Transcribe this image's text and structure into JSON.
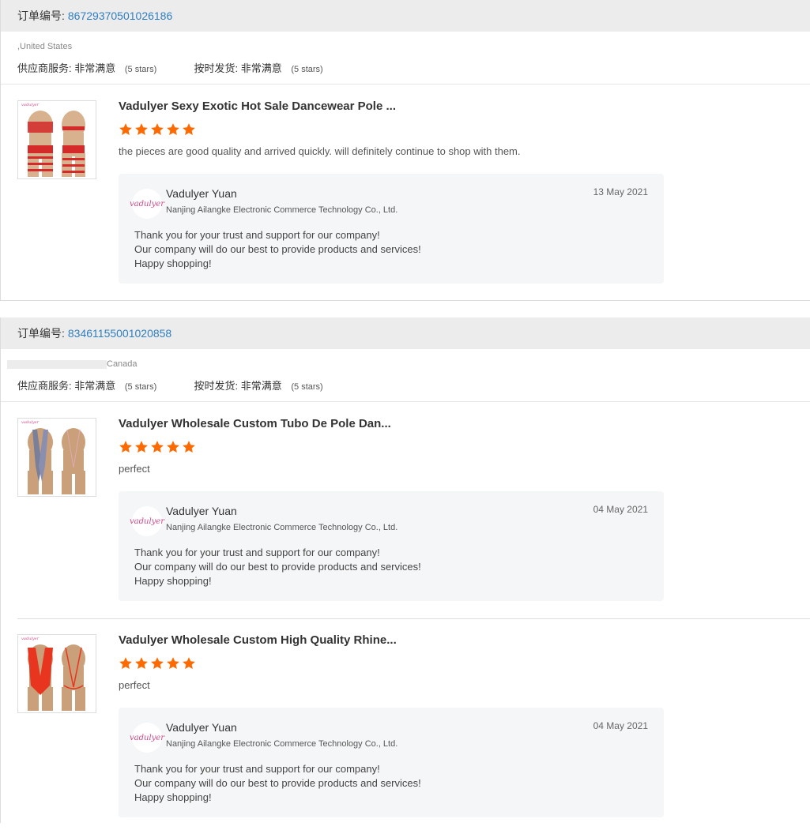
{
  "labels": {
    "order_no": "订单编号:",
    "supplier_service": "供应商服务:",
    "on_time": "按时发货:",
    "very_satisfied": "非常满意",
    "five_stars": "(5 stars)",
    "brand_mark": "vadulyer"
  },
  "colors": {
    "star": "#ff6a00",
    "link": "#2f7fc1",
    "brand": "#d04a8a"
  },
  "reply_common": {
    "seller": "Vadulyer Yuan",
    "company": "Nanjing Ailangke Electronic Commerce Technology Co., Ltd.",
    "line1": "Thank you for your trust and support for our company!",
    "line2": "Our company will do our best to provide products and services!",
    "line3": "Happy shopping!"
  },
  "orders": [
    {
      "number": "86729370501026186",
      "country": ",United States",
      "items": [
        {
          "title": "Vadulyer Sexy Exotic Hot Sale Dancewear Pole ...",
          "stars": 5,
          "review": "the pieces are good quality and arrived quickly. will definitely continue to shop with them.",
          "date": "13 May 2021"
        }
      ]
    },
    {
      "number": "83461155001020858",
      "country": "Canada",
      "items": [
        {
          "title": "Vadulyer Wholesale Custom Tubo De Pole Dan...",
          "stars": 5,
          "review": "perfect",
          "date": "04 May 2021"
        },
        {
          "title": "Vadulyer Wholesale Custom High Quality Rhine...",
          "stars": 5,
          "review": "perfect",
          "date": "04 May 2021"
        }
      ]
    }
  ]
}
